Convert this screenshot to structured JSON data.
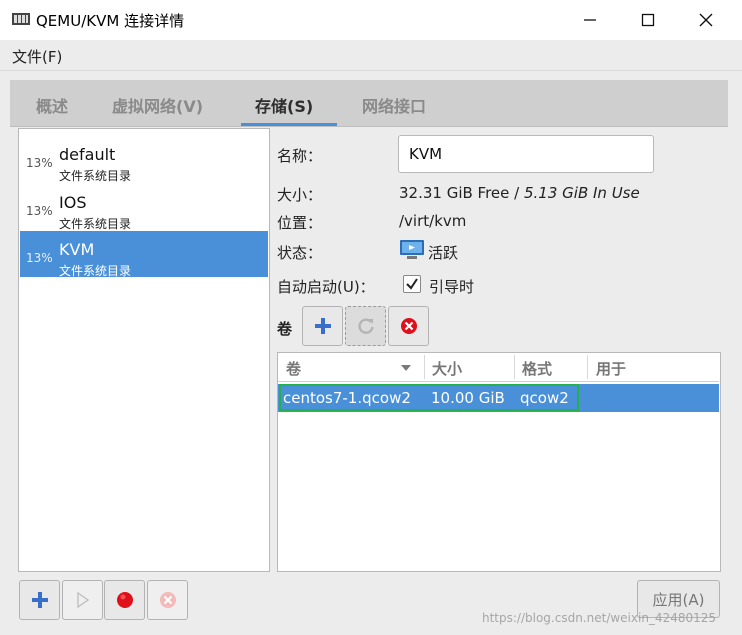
{
  "window": {
    "title": "QEMU/KVM 连接详情",
    "controls": {
      "minimize": "minimize-icon",
      "maximize": "maximize-icon",
      "close": "close-icon"
    }
  },
  "menubar": {
    "file": "文件(F)"
  },
  "tabs": [
    {
      "label": "概述",
      "active": false
    },
    {
      "label": "虚拟网络(V)",
      "active": false
    },
    {
      "label": "存储(S)",
      "active": true
    },
    {
      "label": "网络接口",
      "active": false
    }
  ],
  "pools": [
    {
      "percent": "13%",
      "name": "default",
      "type": "文件系统目录",
      "selected": false
    },
    {
      "percent": "13%",
      "name": "IOS",
      "type": "文件系统目录",
      "selected": false
    },
    {
      "percent": "13%",
      "name": "KVM",
      "type": "文件系统目录",
      "selected": true
    }
  ],
  "pool_toolbar": {
    "add": "add-pool-icon",
    "start": "start-pool-icon",
    "stop": "stop-pool-icon",
    "delete": "delete-pool-icon"
  },
  "details": {
    "name_label": "名称：",
    "name_value": "KVM",
    "size_label": "大小：",
    "size_free": "32.31 GiB Free",
    "size_sep": " / ",
    "size_inuse": "5.13 GiB In Use",
    "location_label": "位置：",
    "location_value": "/virt/kvm",
    "state_label": "状态：",
    "state_value": "活跃",
    "autostart_label": "自动启动(U)：",
    "autostart_value": "引导时",
    "autostart_checked": true
  },
  "volumes": {
    "label": "卷",
    "columns": [
      "卷",
      "大小",
      "格式",
      "用于"
    ],
    "rows": [
      {
        "name": "centos7-1.qcow2",
        "size": "10.00 GiB",
        "format": "qcow2",
        "used_by": ""
      }
    ]
  },
  "apply_button": "应用(A)",
  "watermark": "https://blog.csdn.net/weixin_42480125",
  "colors": {
    "selection": "#4a90d9",
    "highlight_box": "#22b14c",
    "stop_red": "#e0101a"
  }
}
